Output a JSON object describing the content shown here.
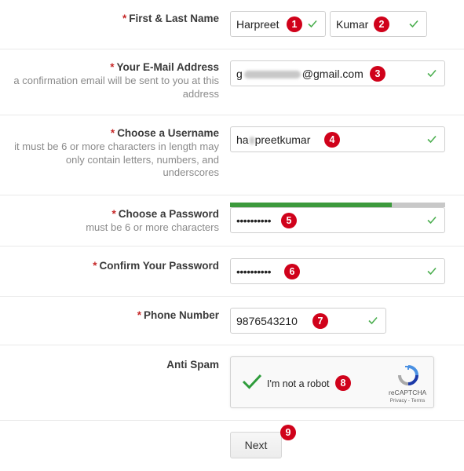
{
  "form": {
    "name": {
      "required_mark": "*",
      "label": "First & Last Name",
      "first_value": "Harpreet",
      "last_value": "Kumar"
    },
    "email": {
      "required_mark": "*",
      "label": "Your E-Mail Address",
      "help": "a confirmation email will be sent to you at this address",
      "value_prefix": "g",
      "value_suffix": "@gmail.com"
    },
    "username": {
      "required_mark": "*",
      "label": "Choose a Username",
      "help": "it must be 6 or more characters in length may only contain letters, numbers, and underscores",
      "value_prefix": "ha",
      "value_suffix": "preetkumar"
    },
    "password": {
      "required_mark": "*",
      "label": "Choose a Password",
      "help": "must be 6 or more characters",
      "value": "••••••••••",
      "strength": 0.75
    },
    "confirm_password": {
      "required_mark": "*",
      "label": "Confirm Your Password",
      "value": "••••••••••"
    },
    "phone": {
      "required_mark": "*",
      "label": "Phone Number",
      "value": "9876543210"
    },
    "anti_spam": {
      "label": "Anti Spam",
      "checkbox_text": "I'm not a robot",
      "brand": "reCAPTCHA",
      "terms": "Privacy - Terms"
    },
    "next_label": "Next"
  },
  "badges": [
    "1",
    "2",
    "3",
    "4",
    "5",
    "6",
    "7",
    "8",
    "9"
  ],
  "colors": {
    "required": "#c62828",
    "valid_check": "#4caf50",
    "badge": "#d0021b",
    "strength_fill": "#3c9a3c"
  }
}
